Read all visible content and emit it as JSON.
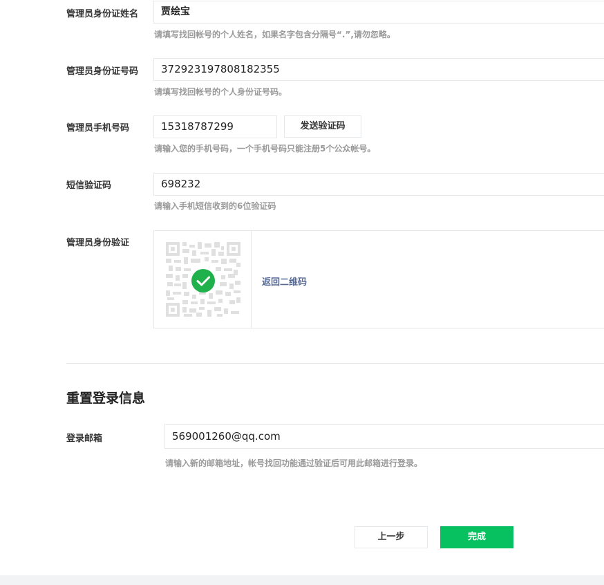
{
  "form": {
    "admin_name": {
      "label": "管理员身份证姓名",
      "value": "贾绘宝",
      "hint": "请填写找回帐号的个人姓名，如果名字包含分隔号“.”,请勿忽略。"
    },
    "admin_id_number": {
      "label": "管理员身份证号码",
      "value": "372923197808182355",
      "hint": "请填写找回帐号的个人身份证号码。"
    },
    "admin_phone": {
      "label": "管理员手机号码",
      "value": "15318787299",
      "send_code_label": "发送验证码",
      "hint": "请输入您的手机号码，一个手机号码只能注册5个公众帐号。"
    },
    "sms_code": {
      "label": "短信验证码",
      "value": "698232",
      "hint": "请输入手机短信收到的6位验证码"
    },
    "admin_verify": {
      "label": "管理员身份验证",
      "back_to_qr_label": "返回二维码",
      "qr_icon": "qr-code-icon",
      "status_icon": "check-circle-icon",
      "status_color": "#20b04c"
    }
  },
  "reset": {
    "title": "重置登录信息",
    "email": {
      "label": "登录邮箱",
      "value": "569001260@qq.com",
      "hint": "请输入新的邮箱地址，帐号找回功能通过验证后可用此邮箱进行登录。"
    }
  },
  "actions": {
    "prev_label": "上一步",
    "done_label": "完成",
    "primary_color": "#07c160"
  }
}
